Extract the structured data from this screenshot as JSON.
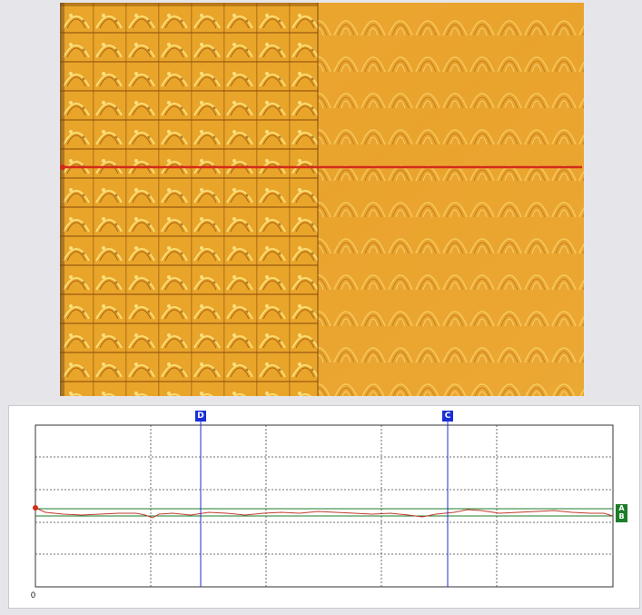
{
  "profile": {
    "cursor_d_label": "D",
    "cursor_c_label": "C",
    "marker_a_label": "A",
    "marker_b_label": "B",
    "origin_label": "0"
  },
  "colors": {
    "texture_base": "#e8a326",
    "profile_line": "#d42a1a",
    "cursor_blue": "#1a2fd6",
    "reference_green": "#1d7d2a"
  }
}
